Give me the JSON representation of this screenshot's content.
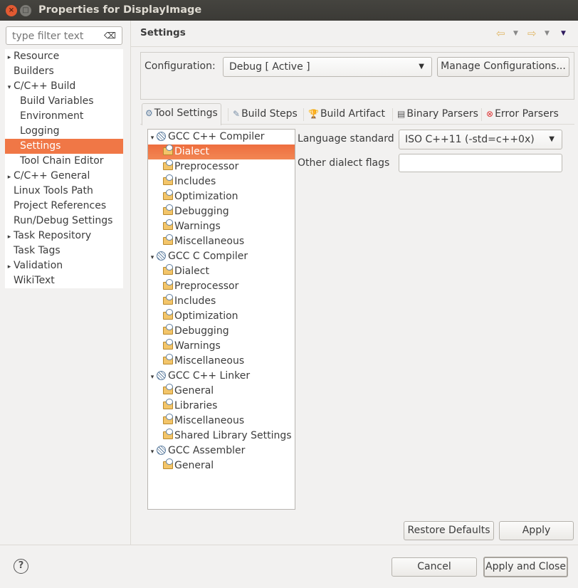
{
  "window": {
    "title": "Properties for DisplayImage",
    "close_glyph": "×",
    "max_glyph": "□"
  },
  "filter": {
    "placeholder": "type filter text",
    "clear_icon": "⌫"
  },
  "nav": [
    {
      "label": "Resource",
      "level": 0,
      "twisty": "▸"
    },
    {
      "label": "Builders",
      "level": 0,
      "twisty": ""
    },
    {
      "label": "C/C++ Build",
      "level": 0,
      "twisty": "▾"
    },
    {
      "label": "Build Variables",
      "level": 1,
      "twisty": ""
    },
    {
      "label": "Environment",
      "level": 1,
      "twisty": ""
    },
    {
      "label": "Logging",
      "level": 1,
      "twisty": ""
    },
    {
      "label": "Settings",
      "level": 1,
      "twisty": "",
      "selected": true
    },
    {
      "label": "Tool Chain Editor",
      "level": 1,
      "twisty": ""
    },
    {
      "label": "C/C++ General",
      "level": 0,
      "twisty": "▸"
    },
    {
      "label": "Linux Tools Path",
      "level": 0,
      "twisty": ""
    },
    {
      "label": "Project References",
      "level": 0,
      "twisty": ""
    },
    {
      "label": "Run/Debug Settings",
      "level": 0,
      "twisty": ""
    },
    {
      "label": "Task Repository",
      "level": 0,
      "twisty": "▸"
    },
    {
      "label": "Task Tags",
      "level": 0,
      "twisty": ""
    },
    {
      "label": "Validation",
      "level": 0,
      "twisty": "▸"
    },
    {
      "label": "WikiText",
      "level": 0,
      "twisty": ""
    }
  ],
  "page": {
    "title": "Settings",
    "back_glyph": "⇦",
    "forward_glyph": "⇨",
    "dropdown_glyph": "▼",
    "menu_color": "#2e1a5e"
  },
  "config": {
    "label": "Configuration:",
    "value": "Debug  [ Active ]",
    "manage_label": "Manage Configurations..."
  },
  "tabs": [
    {
      "label": "Tool Settings",
      "icon": "⚙",
      "active": true
    },
    {
      "label": "Build Steps",
      "icon": "✎"
    },
    {
      "label": "Build Artifact",
      "icon": "🏆"
    },
    {
      "label": "Binary Parsers",
      "icon": "▤"
    },
    {
      "label": "Error Parsers",
      "icon": "⊗"
    }
  ],
  "tool_tree": [
    {
      "label": "GCC C++ Compiler",
      "tool": true
    },
    {
      "label": "Dialect",
      "selected": true
    },
    {
      "label": "Preprocessor"
    },
    {
      "label": "Includes"
    },
    {
      "label": "Optimization"
    },
    {
      "label": "Debugging"
    },
    {
      "label": "Warnings"
    },
    {
      "label": "Miscellaneous"
    },
    {
      "label": "GCC C Compiler",
      "tool": true
    },
    {
      "label": "Dialect"
    },
    {
      "label": "Preprocessor"
    },
    {
      "label": "Includes"
    },
    {
      "label": "Optimization"
    },
    {
      "label": "Debugging"
    },
    {
      "label": "Warnings"
    },
    {
      "label": "Miscellaneous"
    },
    {
      "label": "GCC C++ Linker",
      "tool": true
    },
    {
      "label": "General"
    },
    {
      "label": "Libraries"
    },
    {
      "label": "Miscellaneous"
    },
    {
      "label": "Shared Library Settings"
    },
    {
      "label": "GCC Assembler",
      "tool": true
    },
    {
      "label": "General"
    }
  ],
  "dialect": {
    "language_standard_label": "Language standard",
    "language_standard_value": "ISO C++11 (-std=c++0x)",
    "other_flags_label": "Other dialect flags",
    "other_flags_value": ""
  },
  "buttons": {
    "restore_defaults": "Restore Defaults",
    "apply": "Apply",
    "cancel": "Cancel",
    "apply_and_close": "Apply and Close",
    "help": "?"
  },
  "colors": {
    "selection": "#f07746",
    "titlebar": "#3d3c38",
    "close": "#e25a32"
  }
}
